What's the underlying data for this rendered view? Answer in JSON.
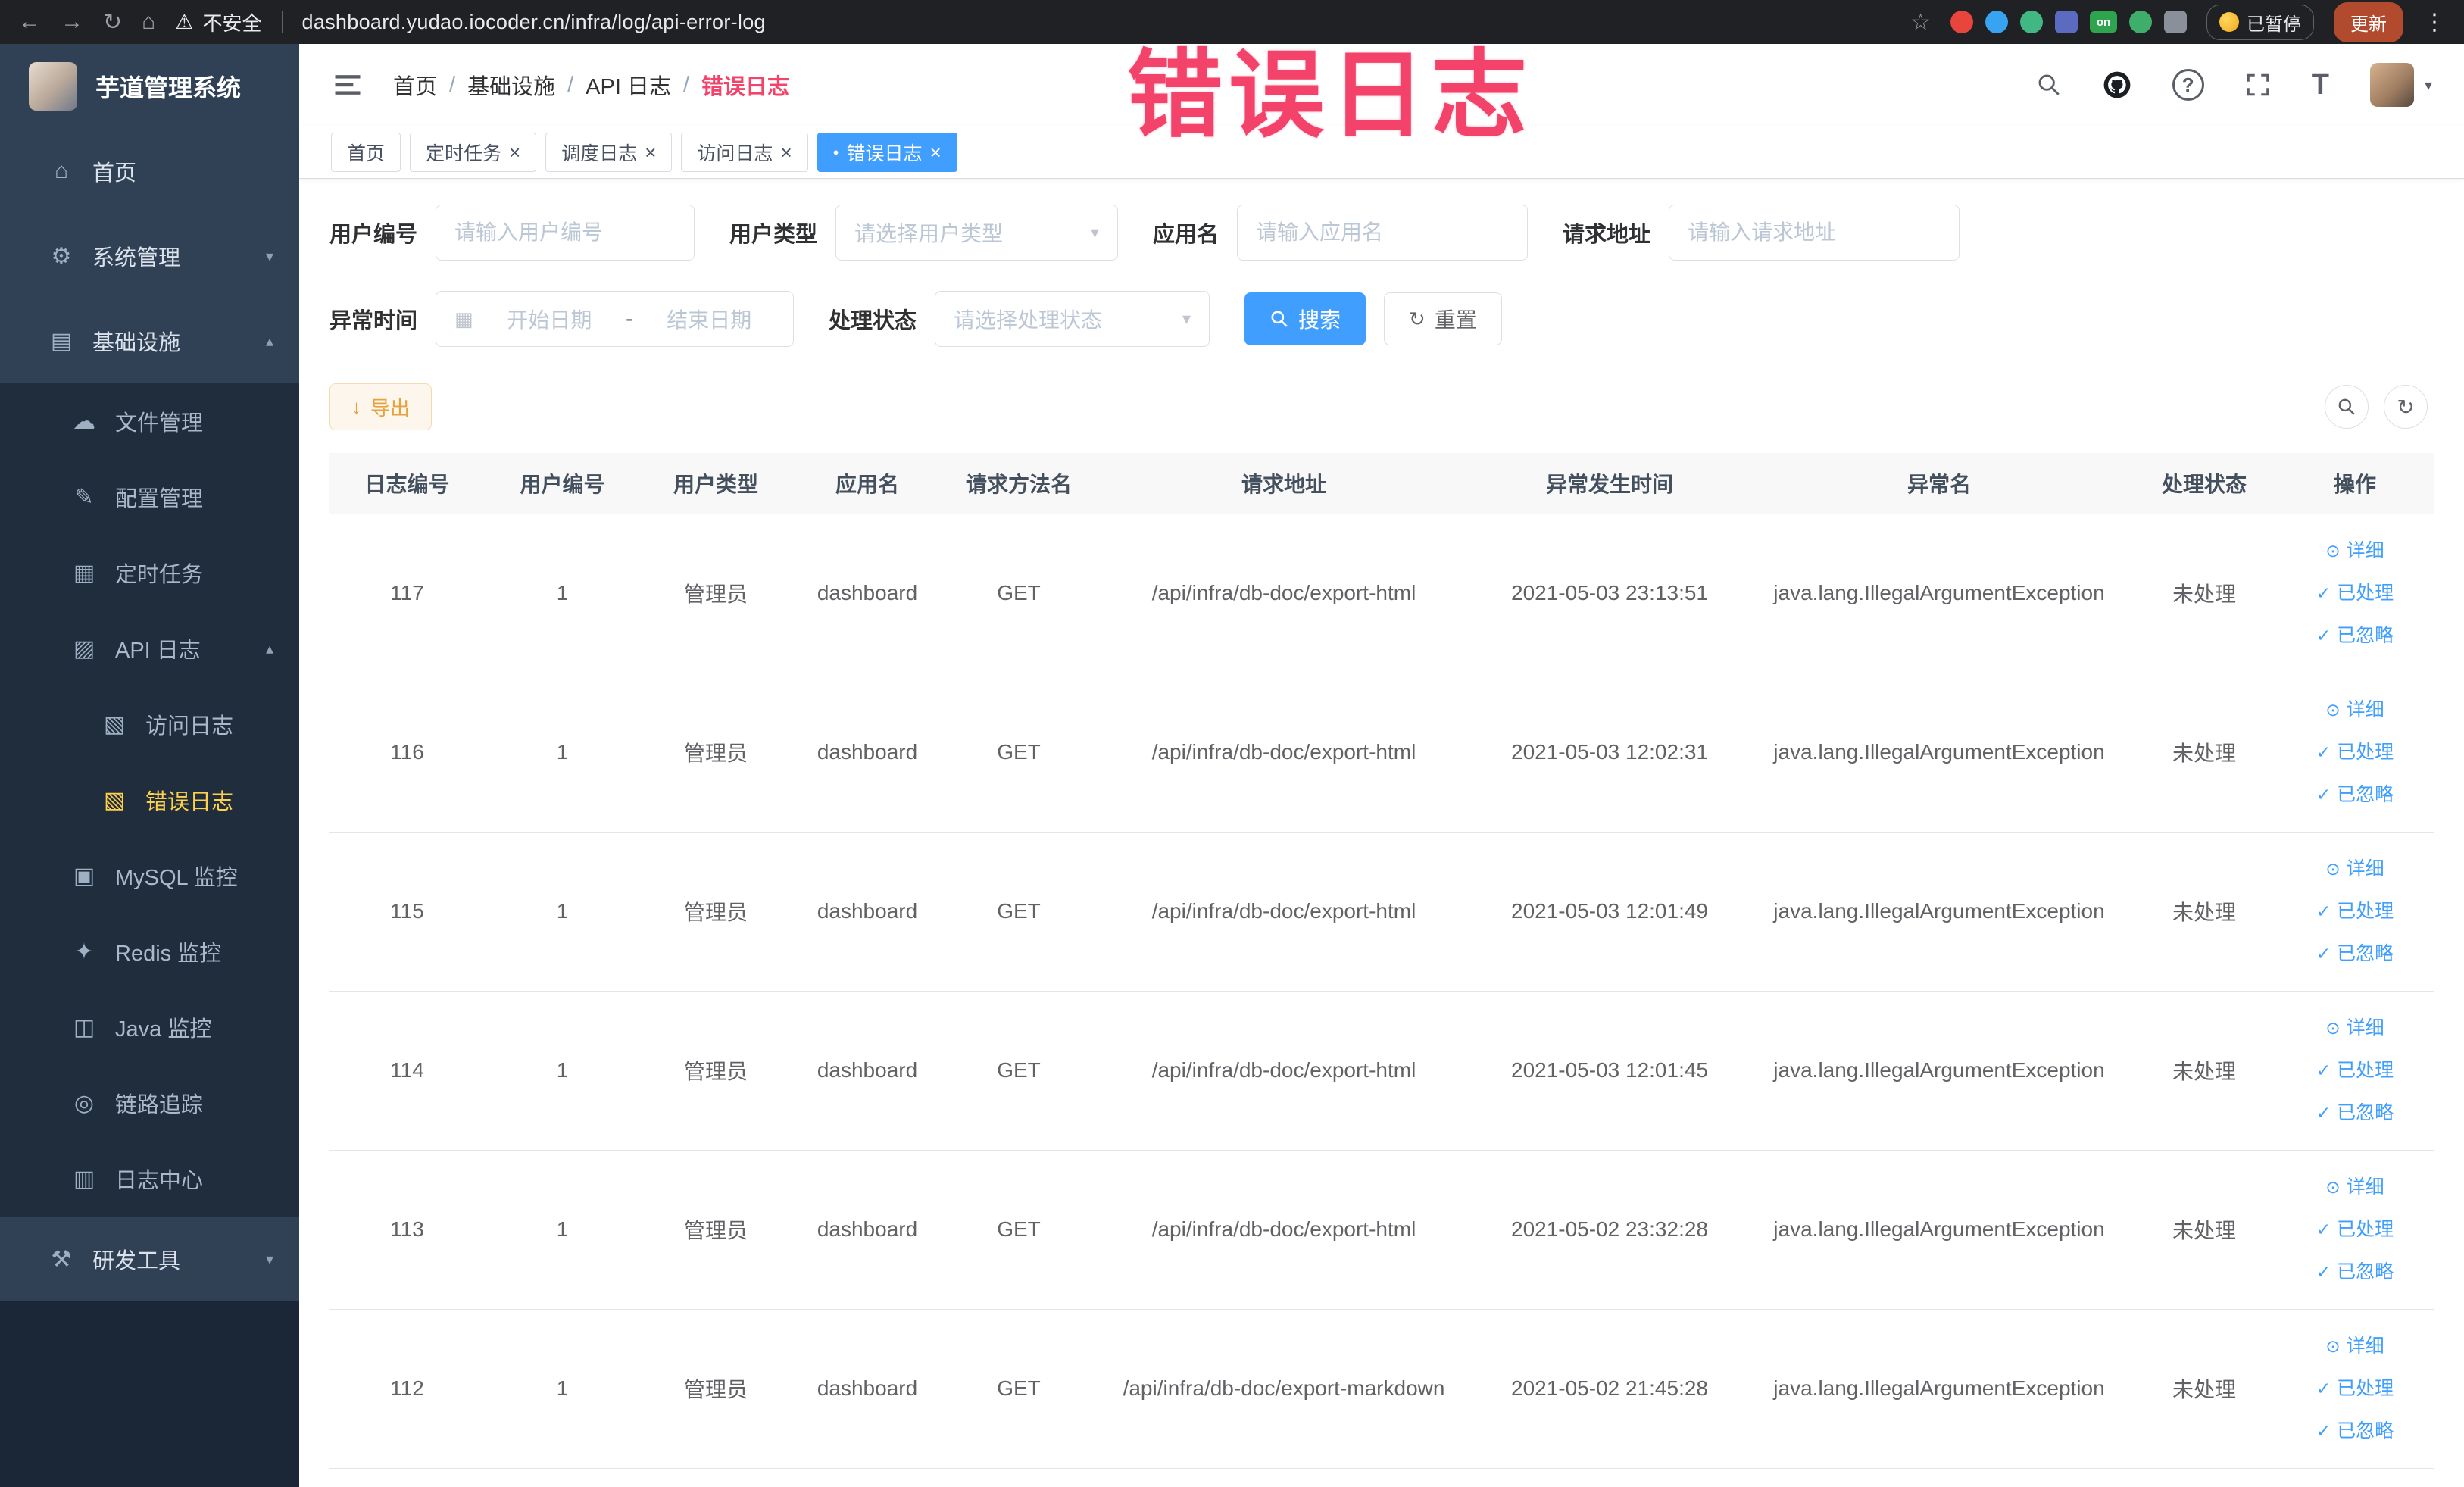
{
  "browser": {
    "back": "←",
    "forward": "→",
    "reload": "↻",
    "home": "⌂",
    "warning_icon": "⚠",
    "security_label": "不安全",
    "url": "dashboard.yudao.iocoder.cn/infra/log/api-error-log",
    "star_icon": "☆",
    "ext_on_label": "on",
    "paused_label": "已暂停",
    "update_label": "更新",
    "menu_icon": "⋮"
  },
  "annotation": {
    "text": "错误日志"
  },
  "sidebar": {
    "title": "芋道管理系统",
    "items": [
      {
        "label": "首页",
        "icon": "⌂"
      },
      {
        "label": "系统管理",
        "icon": "⚙",
        "chevron": "▾"
      },
      {
        "label": "基础设施",
        "icon": "▤",
        "chevron": "▴"
      },
      {
        "label": "文件管理",
        "icon": "☁"
      },
      {
        "label": "配置管理",
        "icon": "✎"
      },
      {
        "label": "定时任务",
        "icon": "▦"
      },
      {
        "label": "API 日志",
        "icon": "▨",
        "chevron": "▴"
      },
      {
        "label": "访问日志",
        "icon": "▧"
      },
      {
        "label": "错误日志",
        "icon": "▧"
      },
      {
        "label": "MySQL 监控",
        "icon": "▣"
      },
      {
        "label": "Redis 监控",
        "icon": "✦"
      },
      {
        "label": "Java 监控",
        "icon": "◫"
      },
      {
        "label": "链路追踪",
        "icon": "◎"
      },
      {
        "label": "日志中心",
        "icon": "▥"
      },
      {
        "label": "研发工具",
        "icon": "⚒",
        "chevron": "▾"
      }
    ]
  },
  "header": {
    "breadcrumb": [
      "首页",
      "基础设施",
      "API 日志",
      "错误日志"
    ],
    "separator": "/",
    "help_icon": "?",
    "font_icon": "T"
  },
  "tabs": [
    {
      "label": "首页"
    },
    {
      "label": "定时任务",
      "close": "×"
    },
    {
      "label": "调度日志",
      "close": "×"
    },
    {
      "label": "访问日志",
      "close": "×"
    },
    {
      "label": "错误日志",
      "close": "×",
      "dot": "●"
    }
  ],
  "filters": {
    "user_id": {
      "label": "用户编号",
      "placeholder": "请输入用户编号"
    },
    "user_type": {
      "label": "用户类型",
      "placeholder": "请选择用户类型"
    },
    "app_name": {
      "label": "应用名",
      "placeholder": "请输入应用名"
    },
    "request_url": {
      "label": "请求地址",
      "placeholder": "请输入请求地址"
    },
    "exception_time": {
      "label": "异常时间",
      "icon": "▦",
      "start": "开始日期",
      "sep": "-",
      "end": "结束日期"
    },
    "process_status": {
      "label": "处理状态",
      "placeholder": "请选择处理状态"
    },
    "search_label": "搜索",
    "reset_label": "重置",
    "reset_icon": "↻"
  },
  "toolbar": {
    "export_icon": "↓",
    "export_label": "导出",
    "refresh_icon": "↻"
  },
  "table": {
    "columns": [
      "日志编号",
      "用户编号",
      "用户类型",
      "应用名",
      "请求方法名",
      "请求地址",
      "异常发生时间",
      "异常名",
      "处理状态",
      "操作"
    ],
    "row_actions": [
      {
        "icon": "⊙",
        "label": "详细"
      },
      {
        "icon": "✓",
        "label": "已处理"
      },
      {
        "icon": "✓",
        "label": "已忽略"
      }
    ],
    "rows": [
      {
        "id": "117",
        "user_id": "1",
        "user_type": "管理员",
        "app": "dashboard",
        "method": "GET",
        "url": "/api/infra/db-doc/export-html",
        "time": "2021-05-03 23:13:51",
        "exception": "java.lang.IllegalArgumentException",
        "status": "未处理"
      },
      {
        "id": "116",
        "user_id": "1",
        "user_type": "管理员",
        "app": "dashboard",
        "method": "GET",
        "url": "/api/infra/db-doc/export-html",
        "time": "2021-05-03 12:02:31",
        "exception": "java.lang.IllegalArgumentException",
        "status": "未处理"
      },
      {
        "id": "115",
        "user_id": "1",
        "user_type": "管理员",
        "app": "dashboard",
        "method": "GET",
        "url": "/api/infra/db-doc/export-html",
        "time": "2021-05-03 12:01:49",
        "exception": "java.lang.IllegalArgumentException",
        "status": "未处理"
      },
      {
        "id": "114",
        "user_id": "1",
        "user_type": "管理员",
        "app": "dashboard",
        "method": "GET",
        "url": "/api/infra/db-doc/export-html",
        "time": "2021-05-03 12:01:45",
        "exception": "java.lang.IllegalArgumentException",
        "status": "未处理"
      },
      {
        "id": "113",
        "user_id": "1",
        "user_type": "管理员",
        "app": "dashboard",
        "method": "GET",
        "url": "/api/infra/db-doc/export-html",
        "time": "2021-05-02 23:32:28",
        "exception": "java.lang.IllegalArgumentException",
        "status": "未处理"
      },
      {
        "id": "112",
        "user_id": "1",
        "user_type": "管理员",
        "app": "dashboard",
        "method": "GET",
        "url": "/api/infra/db-doc/export-markdown",
        "time": "2021-05-02 21:45:28",
        "exception": "java.lang.IllegalArgumentException",
        "status": "未处理"
      }
    ]
  },
  "ui": {
    "caret": "▾"
  },
  "colors": {
    "accent": "#409EFF",
    "sidebar_bg": "#304156",
    "submenu_bg": "#1f2d3d",
    "active_menu_text": "#ffd04b",
    "annotation": "#f4436a",
    "warning": "#e6a23c",
    "chrome_bg": "#202124"
  }
}
